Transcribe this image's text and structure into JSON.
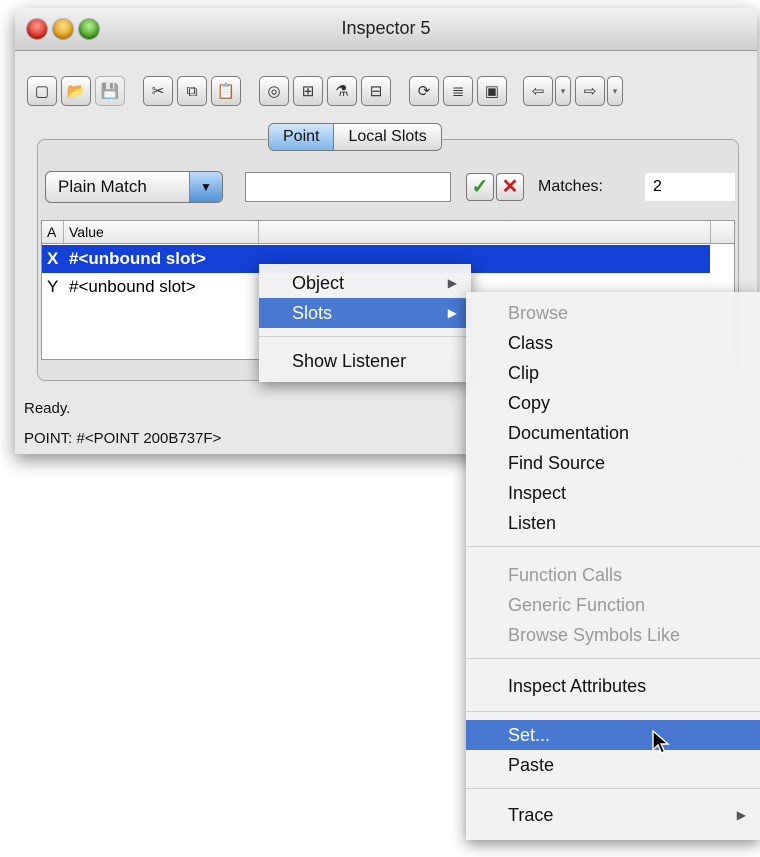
{
  "window": {
    "title": "Inspector 5"
  },
  "toolbar": {
    "buttons": [
      {
        "name": "new-document-icon",
        "glyph": "▢"
      },
      {
        "name": "open-folder-icon",
        "glyph": "📂"
      },
      {
        "name": "save-disk-icon",
        "glyph": "💾"
      },
      {
        "name": "cut-scissors-icon",
        "glyph": "✂"
      },
      {
        "name": "copy-icon",
        "glyph": "⧉"
      },
      {
        "name": "paste-clipboard-icon",
        "glyph": "📋"
      },
      {
        "name": "listener-icon",
        "glyph": "◎"
      },
      {
        "name": "browse-icon",
        "glyph": "⊞"
      },
      {
        "name": "inspect-microscope-icon",
        "glyph": "⚗"
      },
      {
        "name": "class-tree-icon",
        "glyph": "⊟"
      },
      {
        "name": "refresh-icon",
        "glyph": "⟳"
      },
      {
        "name": "hierarchy-icon",
        "glyph": "≣"
      },
      {
        "name": "text-icon",
        "glyph": "▣"
      },
      {
        "name": "back-arrow-icon",
        "glyph": "⇦"
      },
      {
        "name": "back-history-dropdown-icon",
        "glyph": "▾"
      },
      {
        "name": "forward-arrow-icon",
        "glyph": "⇨"
      },
      {
        "name": "forward-history-dropdown-icon",
        "glyph": "▾"
      }
    ]
  },
  "tabs": [
    {
      "label": "Point",
      "active": true
    },
    {
      "label": "Local Slots",
      "active": false
    }
  ],
  "filter": {
    "match_mode": "Plain Match",
    "search_value": "",
    "matches_label": "Matches:",
    "matches_value": "2"
  },
  "table": {
    "columns": [
      "A",
      "Value"
    ],
    "rows": [
      {
        "a": "X",
        "value": "#<unbound slot>",
        "selected": true
      },
      {
        "a": "Y",
        "value": "#<unbound slot>",
        "selected": false
      }
    ]
  },
  "status": {
    "text": "Ready.",
    "info": "POINT: #<POINT 200B737F>"
  },
  "context_menu": {
    "items": [
      {
        "label": "Object",
        "submenu": true,
        "highlighted": false
      },
      {
        "label": "Slots",
        "submenu": true,
        "highlighted": true
      },
      {
        "label": "Show Listener",
        "submenu": false,
        "highlighted": false
      }
    ]
  },
  "slots_submenu": {
    "items": [
      {
        "label": "Browse",
        "disabled": true
      },
      {
        "label": "Class"
      },
      {
        "label": "Clip"
      },
      {
        "label": "Copy"
      },
      {
        "label": "Documentation"
      },
      {
        "label": "Find Source"
      },
      {
        "label": "Inspect"
      },
      {
        "label": "Listen"
      },
      {
        "label": "Function Calls",
        "disabled": true
      },
      {
        "label": "Generic Function",
        "disabled": true
      },
      {
        "label": "Browse Symbols Like",
        "disabled": true
      },
      {
        "label": "Inspect Attributes"
      },
      {
        "label": "Set...",
        "highlighted": true
      },
      {
        "label": "Paste"
      },
      {
        "label": "Trace",
        "submenu": true
      }
    ]
  },
  "submenu_arrow": "▶",
  "colors": {
    "selection": "#1340d6",
    "menu_highlight": "#4878d0",
    "ok": "#2a9a1e",
    "cancel": "#d01b1b"
  }
}
